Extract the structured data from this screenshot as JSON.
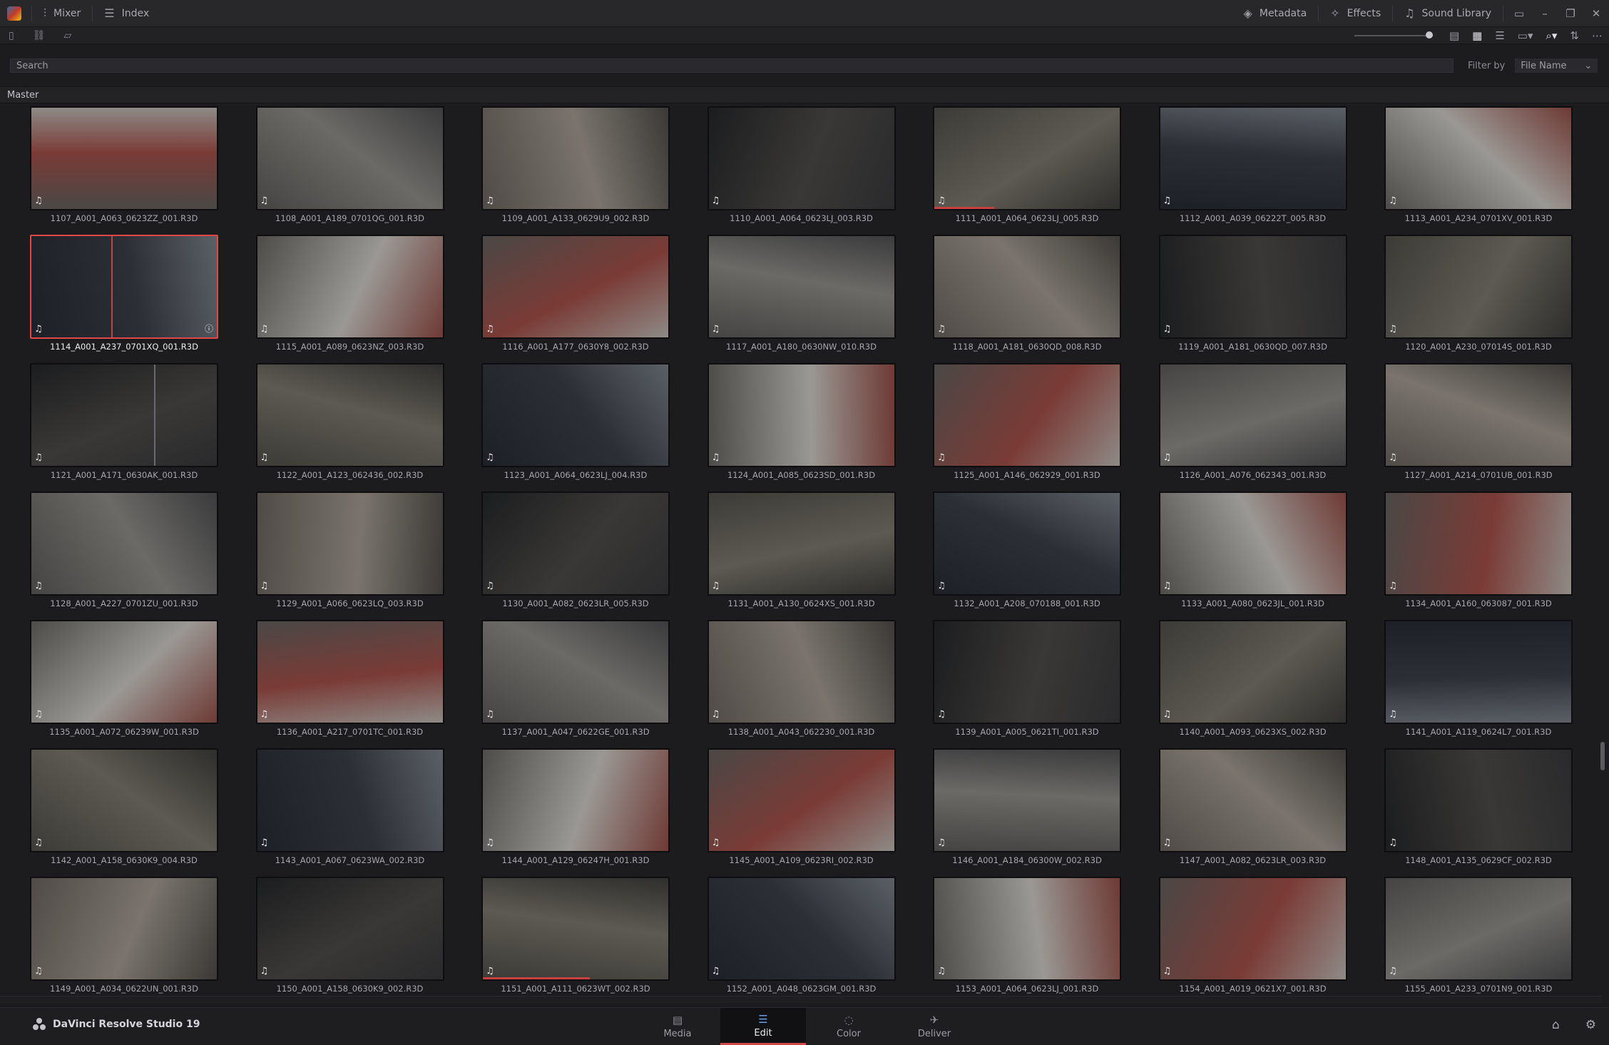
{
  "topbar": {
    "left": [
      {
        "label": "Mixer",
        "icon": "mixer-icon",
        "glyph": "⫶"
      },
      {
        "label": "Index",
        "icon": "index-icon",
        "glyph": "☰"
      }
    ],
    "right": [
      {
        "label": "Metadata",
        "icon": "metadata-icon",
        "glyph": "◈"
      },
      {
        "label": "Effects",
        "icon": "effects-icon",
        "glyph": "✧"
      },
      {
        "label": "Sound Library",
        "icon": "sound-library-icon",
        "glyph": "♫"
      }
    ]
  },
  "search": {
    "placeholder": "Search"
  },
  "filter": {
    "label": "Filter by",
    "value": "File Name"
  },
  "path": "Master",
  "clips": [
    "1107_A001_A063_0623ZZ_001.R3D",
    "1108_A001_A189_0701QG_001.R3D",
    "1109_A001_A133_0629U9_002.R3D",
    "1110_A001_A064_0623LJ_003.R3D",
    "1111_A001_A064_0623LJ_005.R3D",
    "1112_A001_A039_06222T_005.R3D",
    "1113_A001_A234_0701XV_001.R3D",
    "1114_A001_A237_0701XQ_001.R3D",
    "1115_A001_A089_0623NZ_003.R3D",
    "1116_A001_A177_0630Y8_002.R3D",
    "1117_A001_A180_0630NW_010.R3D",
    "1118_A001_A181_0630QD_008.R3D",
    "1119_A001_A181_0630QD_007.R3D",
    "1120_A001_A230_07014S_001.R3D",
    "1121_A001_A171_0630AK_001.R3D",
    "1122_A001_A123_062436_002.R3D",
    "1123_A001_A064_0623LJ_004.R3D",
    "1124_A001_A085_0623SD_001.R3D",
    "1125_A001_A146_062929_001.R3D",
    "1126_A001_A076_062343_001.R3D",
    "1127_A001_A214_0701UB_001.R3D",
    "1128_A001_A227_0701ZU_001.R3D",
    "1129_A001_A066_0623LQ_003.R3D",
    "1130_A001_A082_0623LR_005.R3D",
    "1131_A001_A130_0624XS_001.R3D",
    "1132_A001_A208_070188_001.R3D",
    "1133_A001_A080_0623JL_001.R3D",
    "1134_A001_A160_063087_001.R3D",
    "1135_A001_A072_06239W_001.R3D",
    "1136_A001_A217_0701TC_001.R3D",
    "1137_A001_A047_0622GE_001.R3D",
    "1138_A001_A043_062230_001.R3D",
    "1139_A001_A005_0621TI_001.R3D",
    "1140_A001_A093_0623XS_002.R3D",
    "1141_A001_A119_0624L7_001.R3D",
    "1142_A001_A158_0630K9_004.R3D",
    "1143_A001_A067_0623WA_002.R3D",
    "1144_A001_A129_06247H_001.R3D",
    "1145_A001_A109_0623RI_002.R3D",
    "1146_A001_A184_06300W_002.R3D",
    "1147_A001_A082_0623LR_003.R3D",
    "1148_A001_A135_0629CF_002.R3D",
    "1149_A001_A034_0622UN_001.R3D",
    "1150_A001_A158_0630K9_002.R3D",
    "1151_A001_A111_0623WT_002.R3D",
    "1152_A001_A048_0623GM_001.R3D",
    "1153_A001_A064_0623LJ_001.R3D",
    "1154_A001_A019_0621X7_001.R3D",
    "1155_A001_A233_0701N9_001.R3D"
  ],
  "selected_index": 7,
  "bottombar": {
    "brand": "DaVinci Resolve Studio 19",
    "pages": [
      {
        "label": "Media",
        "icon": "media-page-icon",
        "glyph": "▤"
      },
      {
        "label": "Edit",
        "icon": "edit-page-icon",
        "glyph": "☰"
      },
      {
        "label": "Color",
        "icon": "color-page-icon",
        "glyph": "◌"
      },
      {
        "label": "Deliver",
        "icon": "deliver-page-icon",
        "glyph": "✈"
      }
    ],
    "active_page": "Edit"
  },
  "colors": {
    "accent": "#d04848",
    "selection": "#e04848"
  }
}
